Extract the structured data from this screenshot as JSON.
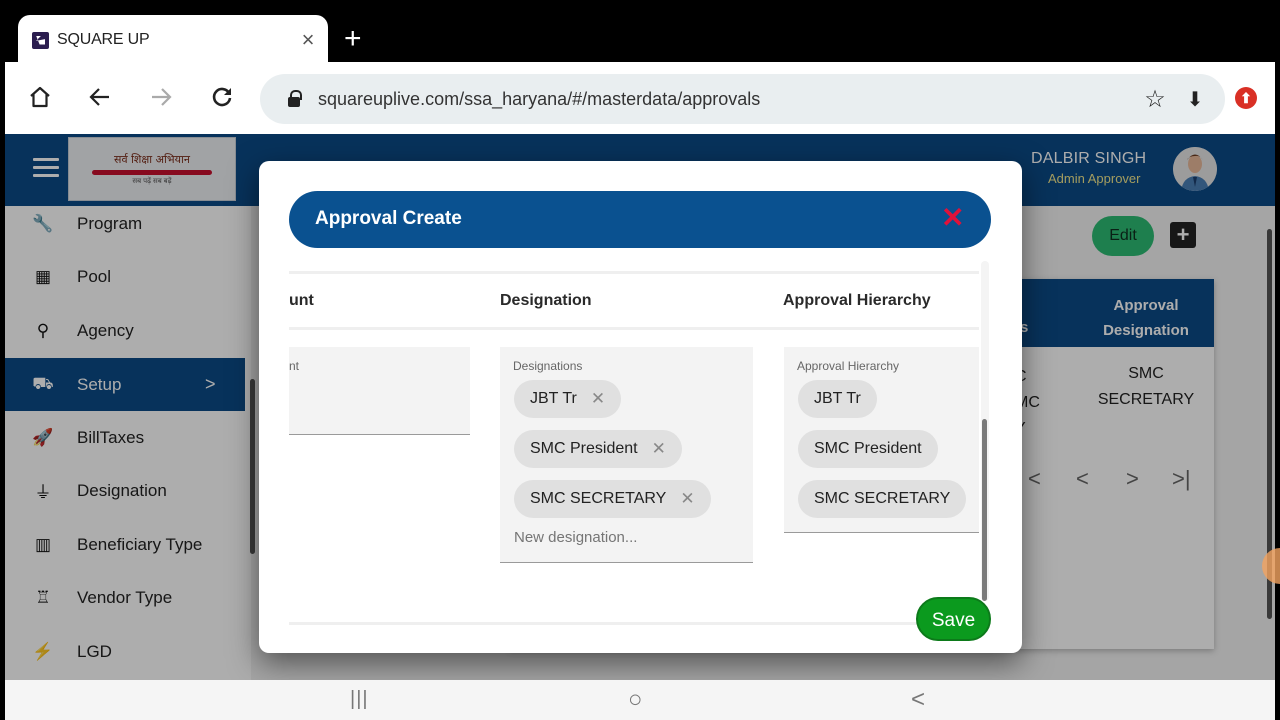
{
  "browser": {
    "tab_title": "SQUARE UP",
    "tab_close": "×",
    "new_tab": "+",
    "url": "squareuplive.com/ssa_haryana/#/masterdata/approvals",
    "icons": {
      "home": "home-icon",
      "back": "arrow-left-icon",
      "forward": "arrow-right-icon",
      "reload": "reload-icon",
      "bookmark": "☆",
      "download": "⬇",
      "extension": "⬆"
    }
  },
  "app": {
    "logo_text": "सर्व शिक्षा अभियान",
    "logo_sub": "सब पढ़ें सब बढ़ें",
    "user": {
      "name": "DALBIR SINGH",
      "role": "Admin Approver"
    },
    "sidebar": {
      "items": [
        {
          "label": "Program",
          "icon": "🔧"
        },
        {
          "label": "Pool",
          "icon": "▦"
        },
        {
          "label": "Agency",
          "icon": "⚲"
        },
        {
          "label": "Setup",
          "icon": "⛟",
          "active": true,
          "chevron": ">"
        },
        {
          "label": "BillTaxes",
          "icon": "🚀"
        },
        {
          "label": "Designation",
          "icon": "⏚"
        },
        {
          "label": "Beneficiary Type",
          "icon": "▥"
        },
        {
          "label": "Vendor Type",
          "icon": "♖"
        },
        {
          "label": "LGD",
          "icon": "⚡"
        }
      ]
    },
    "actions": {
      "edit_label": "Edit",
      "add_label": "+"
    },
    "grid": {
      "header_partial": "s",
      "header_approval_designation": "Approval Designation",
      "cell_partial": "C\nMC\nY",
      "cell_approval_designation": "SMC SECRETARY",
      "pager": {
        "first": "|<",
        "prev": "<",
        "next": ">",
        "last": ">|"
      }
    }
  },
  "modal": {
    "title": "Approval Create",
    "close": "✕",
    "columns": {
      "amount_partial": "unt",
      "designation": "Designation",
      "approval_hierarchy": "Approval Hierarchy"
    },
    "amount_field": {
      "label_partial": "nt",
      "value": ""
    },
    "designations_field": {
      "label": "Designations",
      "chips": [
        "JBT Tr",
        "SMC President",
        "SMC SECRETARY"
      ],
      "chip_remove": "✕",
      "placeholder": "New designation..."
    },
    "hierarchy_field": {
      "label": "Approval Hierarchy",
      "chips": [
        "JBT Tr",
        "SMC President",
        "SMC SECRETARY"
      ]
    },
    "save_label": "Save"
  },
  "android_nav": {
    "recents": "|||",
    "home": "○",
    "back": "<"
  }
}
